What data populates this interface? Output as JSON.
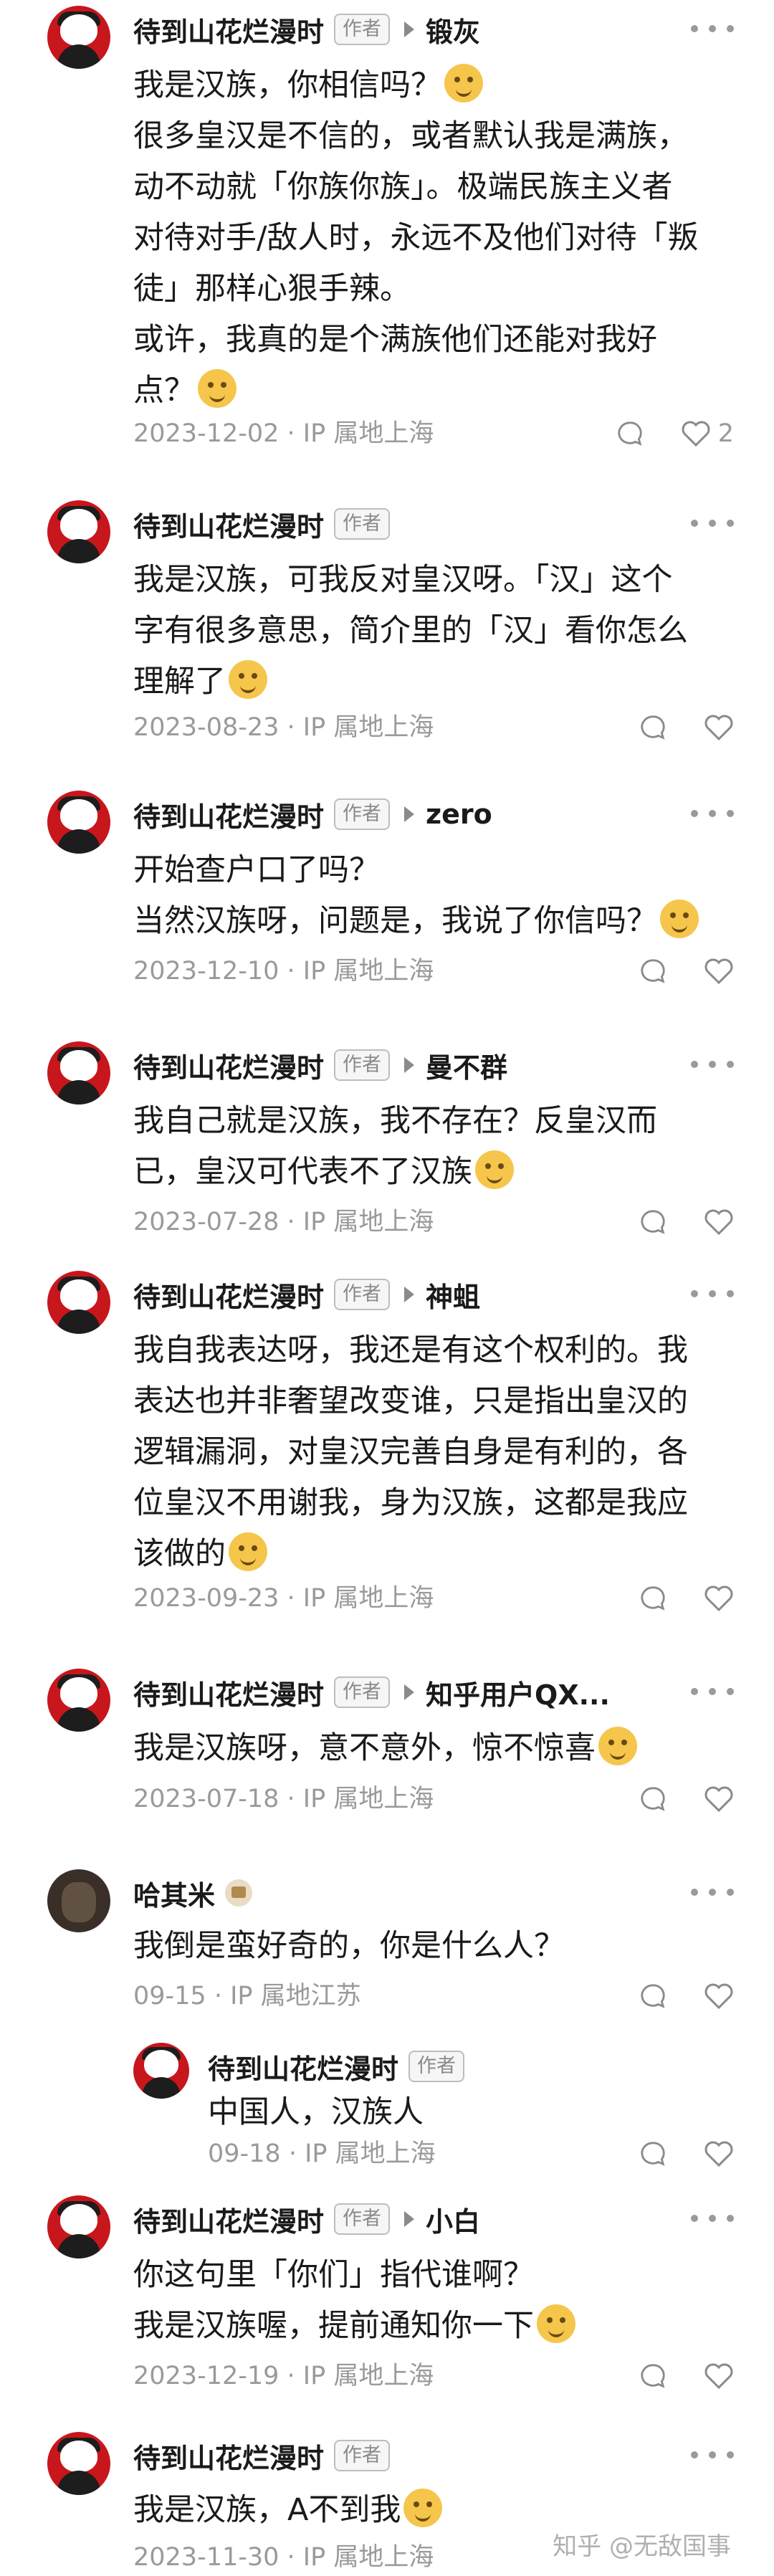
{
  "comments": [
    {
      "author": "待到山花烂漫时",
      "badge": "作者",
      "reply_to": "锻灰",
      "lines": [
        "我是汉族，你相信吗？",
        "很多皇汉是不信的，或者默认我是满族，",
        "动不动就「你族你族」。极端民族主义者",
        "对待对手/敌人时，永远不及他们对待「叛",
        "徒」那样心狠手辣。",
        "或许，我真的是个满族他们还能对我好",
        "点？"
      ],
      "date": "2023-12-02",
      "ip": "IP 属地上海",
      "likes": "2"
    },
    {
      "author": "待到山花烂漫时",
      "badge": "作者",
      "reply_to": "",
      "lines": [
        "我是汉族，可我反对皇汉呀。「汉」这个",
        "字有很多意思，简介里的「汉」看你怎么",
        "理解了"
      ],
      "date": "2023-08-23",
      "ip": "IP 属地上海",
      "likes": ""
    },
    {
      "author": "待到山花烂漫时",
      "badge": "作者",
      "reply_to": "zero",
      "lines": [
        "开始查户口了吗？",
        "当然汉族呀，问题是，我说了你信吗？"
      ],
      "date": "2023-12-10",
      "ip": "IP 属地上海",
      "likes": ""
    },
    {
      "author": "待到山花烂漫时",
      "badge": "作者",
      "reply_to": "曼不群",
      "lines": [
        "我自己就是汉族，我不存在？反皇汉而",
        "已，皇汉可代表不了汉族"
      ],
      "date": "2023-07-28",
      "ip": "IP 属地上海",
      "likes": ""
    },
    {
      "author": "待到山花烂漫时",
      "badge": "作者",
      "reply_to": "神蛆",
      "lines": [
        "我自我表达呀，我还是有这个权利的。我",
        "表达也并非奢望改变谁，只是指出皇汉的",
        "逻辑漏洞，对皇汉完善自身是有利的，各",
        "位皇汉不用谢我，身为汉族，这都是我应",
        "该做的"
      ],
      "date": "2023-09-23",
      "ip": "IP 属地上海",
      "likes": ""
    },
    {
      "author": "待到山花烂漫时",
      "badge": "作者",
      "reply_to": "知乎用户QX...",
      "lines": [
        "我是汉族呀，意不意外，惊不惊喜"
      ],
      "date": "2023-07-18",
      "ip": "IP 属地上海",
      "likes": ""
    },
    {
      "author": "哈其米",
      "badge": "",
      "reply_to": "",
      "lines": [
        "我倒是蛮好奇的，你是什么人？"
      ],
      "date": "09-15",
      "ip": "IP 属地江苏",
      "likes": "",
      "reply": {
        "author": "待到山花烂漫时",
        "badge": "作者",
        "lines": [
          "中国人，汉族人"
        ],
        "date": "09-18",
        "ip": "IP 属地上海"
      }
    },
    {
      "author": "待到山花烂漫时",
      "badge": "作者",
      "reply_to": "小白",
      "lines": [
        "你这句里「你们」指代谁啊？",
        "我是汉族喔，提前通知你一下"
      ],
      "date": "2023-12-19",
      "ip": "IP 属地上海",
      "likes": ""
    },
    {
      "author": "待到山花烂漫时",
      "badge": "作者",
      "reply_to": "",
      "lines": [
        "我是汉族，A不到我"
      ],
      "date": "2023-11-30",
      "ip": "IP 属地上海",
      "likes": ""
    }
  ],
  "watermark": "知乎 @无敌国事",
  "icons": {
    "comment": "comment-bubble-icon",
    "like": "heart-icon",
    "more": "more-dots-icon"
  }
}
